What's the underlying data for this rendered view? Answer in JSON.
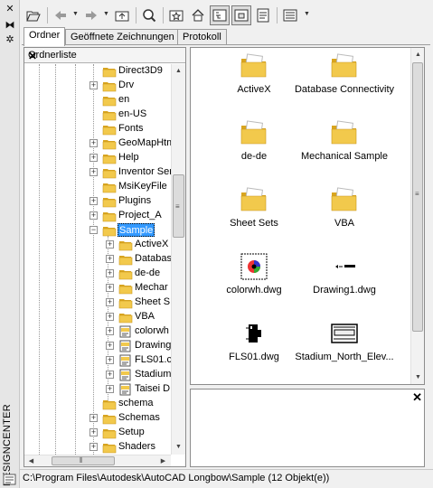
{
  "window": {
    "vertical_title": "DESIGNCENTER"
  },
  "tabs": [
    {
      "label": "Ordner",
      "active": true
    },
    {
      "label": "Geöffnete Zeichnungen",
      "active": false
    },
    {
      "label": "Protokoll",
      "active": false
    }
  ],
  "tree": {
    "header": "Ordnerliste",
    "items": [
      {
        "label": "Direct3D9",
        "indent": 1,
        "expander": "",
        "selected": false
      },
      {
        "label": "Drv",
        "indent": 1,
        "expander": "+",
        "selected": false
      },
      {
        "label": "en",
        "indent": 1,
        "expander": "",
        "selected": false
      },
      {
        "label": "en-US",
        "indent": 1,
        "expander": "",
        "selected": false
      },
      {
        "label": "Fonts",
        "indent": 1,
        "expander": "",
        "selected": false
      },
      {
        "label": "GeoMapHtm",
        "indent": 1,
        "expander": "+",
        "selected": false
      },
      {
        "label": "Help",
        "indent": 1,
        "expander": "+",
        "selected": false
      },
      {
        "label": "Inventor Ser",
        "indent": 1,
        "expander": "+",
        "selected": false
      },
      {
        "label": "MsiKeyFile",
        "indent": 1,
        "expander": "",
        "selected": false
      },
      {
        "label": "Plugins",
        "indent": 1,
        "expander": "+",
        "selected": false
      },
      {
        "label": "Project_A",
        "indent": 1,
        "expander": "+",
        "selected": false
      },
      {
        "label": "Sample",
        "indent": 1,
        "expander": "-",
        "selected": true
      },
      {
        "label": "ActiveX",
        "indent": 2,
        "expander": "+",
        "selected": false
      },
      {
        "label": "Databas",
        "indent": 2,
        "expander": "+",
        "selected": false
      },
      {
        "label": "de-de",
        "indent": 2,
        "expander": "+",
        "selected": false
      },
      {
        "label": "Mechar",
        "indent": 2,
        "expander": "+",
        "selected": false
      },
      {
        "label": "Sheet S",
        "indent": 2,
        "expander": "+",
        "selected": false
      },
      {
        "label": "VBA",
        "indent": 2,
        "expander": "+",
        "selected": false
      },
      {
        "label": "colorwh",
        "indent": 2,
        "expander": "+",
        "selected": false,
        "kind": "file"
      },
      {
        "label": "Drawing",
        "indent": 2,
        "expander": "+",
        "selected": false,
        "kind": "file"
      },
      {
        "label": "FLS01.c",
        "indent": 2,
        "expander": "+",
        "selected": false,
        "kind": "file"
      },
      {
        "label": "Stadium",
        "indent": 2,
        "expander": "+",
        "selected": false,
        "kind": "file"
      },
      {
        "label": "Taisei D",
        "indent": 2,
        "expander": "+",
        "selected": false,
        "kind": "file"
      },
      {
        "label": "schema",
        "indent": 1,
        "expander": "",
        "selected": false
      },
      {
        "label": "Schemas",
        "indent": 1,
        "expander": "+",
        "selected": false
      },
      {
        "label": "Setup",
        "indent": 1,
        "expander": "+",
        "selected": false
      },
      {
        "label": "Shaders",
        "indent": 1,
        "expander": "+",
        "selected": false
      }
    ]
  },
  "content": {
    "items": [
      {
        "label": "ActiveX",
        "icon": "folder-icon"
      },
      {
        "label": "Database Connectivity",
        "icon": "folder-icon"
      },
      {
        "label": "de-de",
        "icon": "folder-icon"
      },
      {
        "label": "Mechanical Sample",
        "icon": "folder-icon"
      },
      {
        "label": "Sheet Sets",
        "icon": "folder-icon"
      },
      {
        "label": "VBA",
        "icon": "folder-icon"
      },
      {
        "label": "colorwh.dwg",
        "icon": "drawing-thumbnail-color-wheel"
      },
      {
        "label": "Drawing1.dwg",
        "icon": "drawing-thumbnail-arrow"
      },
      {
        "label": "FLS01.dwg",
        "icon": "drawing-thumbnail-device"
      },
      {
        "label": "Stadium_North_Elev...",
        "icon": "drawing-thumbnail-elevation"
      }
    ]
  },
  "status": {
    "path": "C:\\Program Files\\Autodesk\\AutoCAD Longbow\\Sample (12 Objekt(e))"
  },
  "colors": {
    "selection": "#3399ff",
    "folder": "#f2c94c",
    "folder_dark": "#d9a520",
    "panel_border": "#8c8c8c"
  }
}
